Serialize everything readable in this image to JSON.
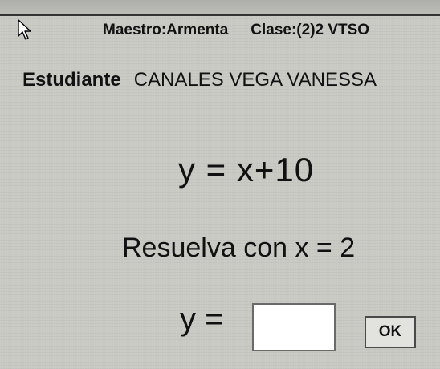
{
  "header": {
    "teacher": "Maestro:Armenta",
    "class": "Clase:(2)2 VTSO"
  },
  "student": {
    "label": "Estudiante",
    "name": "CANALES VEGA VANESSA"
  },
  "problem": {
    "equation": "y = x+10",
    "instruction": "Resuelva con x = 2"
  },
  "answer": {
    "label": "y =",
    "value": ""
  },
  "buttons": {
    "ok_label": "OK"
  },
  "icons": {
    "cursor": "arrow-cursor-icon"
  }
}
